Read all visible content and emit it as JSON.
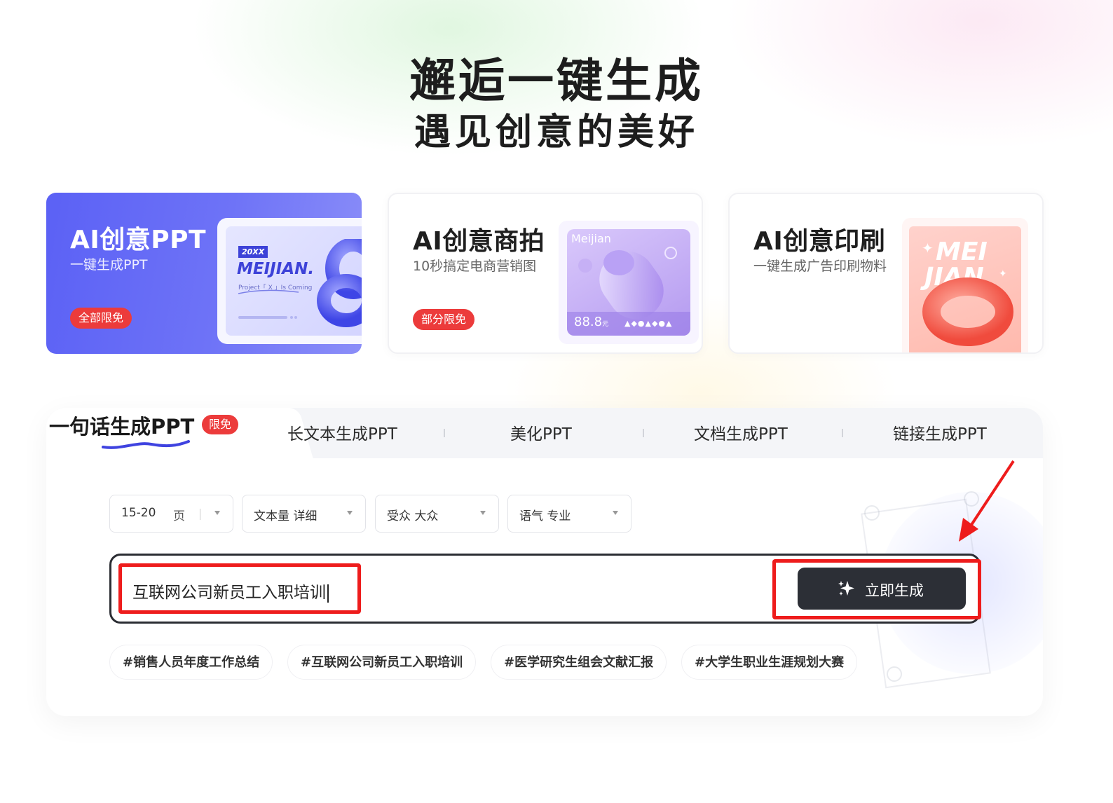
{
  "header": {
    "line1": "邂逅一键生成",
    "line2": "遇见创意的美好"
  },
  "cards": [
    {
      "title": "AI创意PPT",
      "subtitle": "一键生成PPT",
      "badge": "全部限免",
      "thumb_year": "20XX",
      "thumb_brand": "MEIJIAN.",
      "thumb_caption": "Project「 X 」Is Coming"
    },
    {
      "title": "AI创意商拍",
      "subtitle": "10秒搞定电商营销图",
      "badge": "部分限免",
      "thumb_brand": "Meijian",
      "thumb_price": "88.8",
      "thumb_unit": "元"
    },
    {
      "title": "AI创意印刷",
      "subtitle": "一键生成广告印刷物料",
      "thumb_line1": "MEI",
      "thumb_line2": "JIAN"
    }
  ],
  "tabs": {
    "active": {
      "label": "一句话生成PPT",
      "badge": "限免"
    },
    "items": [
      "长文本生成PPT",
      "美化PPT",
      "文档生成PPT",
      "链接生成PPT"
    ]
  },
  "selects": [
    {
      "value": "15-20",
      "unit": "页"
    },
    {
      "value": "文本量 详细"
    },
    {
      "value": "受众 大众"
    },
    {
      "value": "语气 专业"
    }
  ],
  "input": {
    "value": "互联网公司新员工入职培训"
  },
  "generate_button": {
    "label": "立即生成"
  },
  "suggestions": [
    "#销售人员年度工作总结",
    "#互联网公司新员工入职培训",
    "#医学研究生组会文献汇报",
    "#大学生职业生涯规划大赛"
  ],
  "colors": {
    "accent": "#5b61f5",
    "badge": "#ec3b3b",
    "highlight": "#ee1c1c",
    "button": "#2c2f36"
  }
}
